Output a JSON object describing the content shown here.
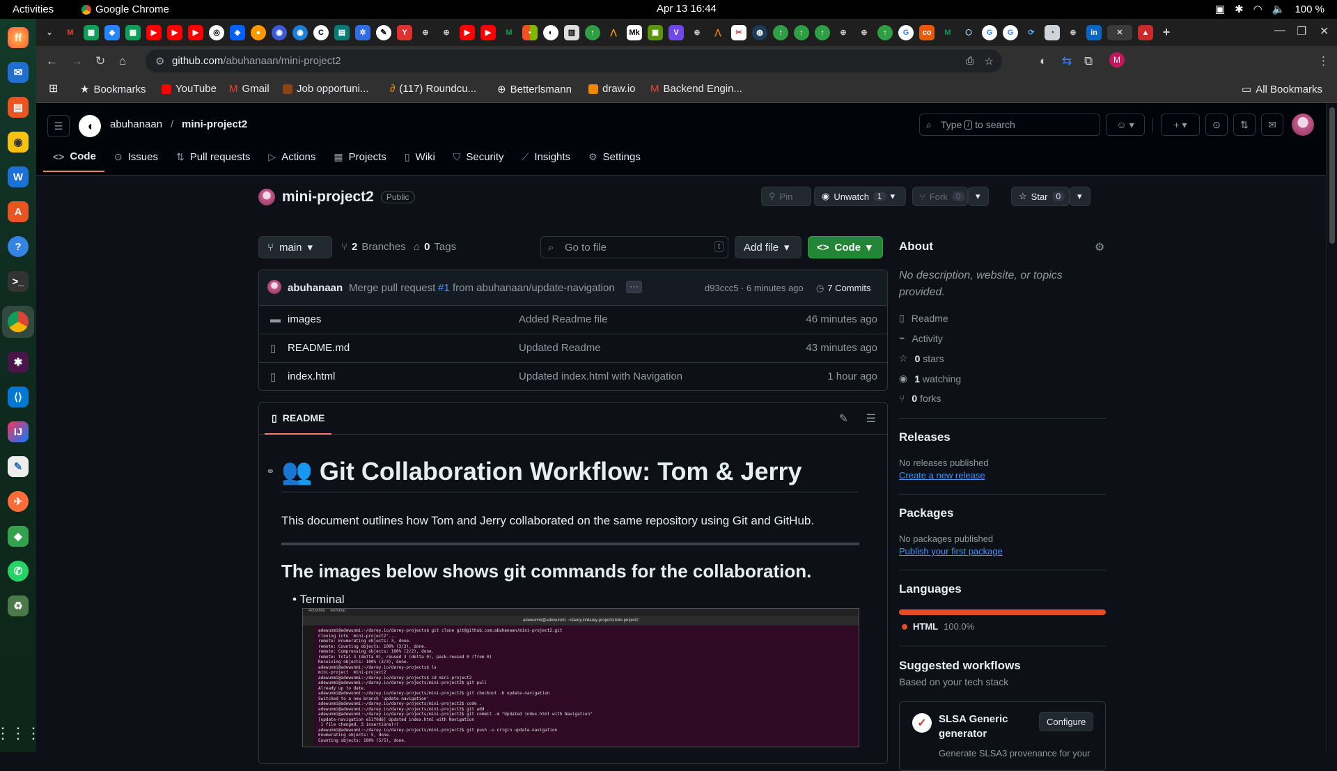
{
  "os": {
    "activities": "Activities",
    "app_name": "Google Chrome",
    "clock": "Apr 13  16:44",
    "battery": "100 %"
  },
  "browser": {
    "url_host": "github.com",
    "url_path": "/abuhanaan/mini-project2",
    "bookmarks": [
      "Bookmarks",
      "YouTube",
      "Gmail",
      "Job opportuni...",
      "(117) Roundcu...",
      "Betterlsmann",
      "draw.io",
      "Backend Engin..."
    ],
    "all_bookmarks": "All Bookmarks"
  },
  "header": {
    "owner": "abuhanaan",
    "sep": "/",
    "repo": "mini-project2",
    "search_placeholder_pre": "Type",
    "search_key": "/",
    "search_placeholder_post": "to search"
  },
  "repo_nav": [
    "Code",
    "Issues",
    "Pull requests",
    "Actions",
    "Projects",
    "Wiki",
    "Security",
    "Insights",
    "Settings"
  ],
  "repo": {
    "name": "mini-project2",
    "visibility": "Public",
    "pin": "Pin",
    "unwatch": "Unwatch",
    "watch_count": "1",
    "fork": "Fork",
    "fork_count": "0",
    "star": "Star",
    "star_count": "0"
  },
  "branchbar": {
    "branch": "main",
    "branches_count": "2",
    "branches_label": "Branches",
    "tags_count": "0",
    "tags_label": "Tags",
    "goto_placeholder": "Go to file",
    "goto_key": "t",
    "add_file": "Add file",
    "code": "Code"
  },
  "commit": {
    "author": "abuhanaan",
    "msg_pre": "Merge pull request",
    "pr": "#1",
    "msg_post": "from abuhanaan/update-navigation",
    "sha_time": "d93ccc5 · 6 minutes ago",
    "commits": "7 Commits"
  },
  "files": [
    {
      "name": "images",
      "type": "dir",
      "message": "Added Readme file",
      "time": "46 minutes ago"
    },
    {
      "name": "README.md",
      "type": "file",
      "message": "Updated Readme",
      "time": "43 minutes ago"
    },
    {
      "name": "index.html",
      "type": "file",
      "message": "Updated index.html with Navigation",
      "time": "1 hour ago"
    }
  ],
  "readme": {
    "tab": "README",
    "title_emoji": "👥",
    "title": "Git Collaboration Workflow: Tom & Jerry",
    "intro": "This document outlines how Tom and Jerry collaborated on the same repository using Git and GitHub.",
    "h2": "The images below shows git commands for the collaboration.",
    "bullet": "Terminal",
    "terminal_lines": "adewunmi@adewunmi:~/darey.io/darey-projects$ git clone git@github.com:abuhanaan/mini-project2.git\nCloning into 'mini-project2'...\nremote: Enumerating objects: 3, done.\nremote: Counting objects: 100% (3/3), done.\nremote: Compressing objects: 100% (2/2), done.\nremote: Total 3 (delta 0), reused 3 (delta 0), pack-reused 0 (from 0)\nReceiving objects: 100% (3/3), done.\nadewunmi@adewunmi:~/darey.io/darey-projects$ ls\nmini-project  mini-project2\nadewunmi@adewunmi:~/darey.io/darey-projects$ cd mini-project2\nadewunmi@adewunmi:~/darey.io/darey-projects/mini-project2$ git pull\nAlready up to date.\nadewunmi@adewunmi:~/darey.io/darey-projects/mini-project2$ git checkout -b update-navigation\nSwitched to a new branch 'update-navigation'\nadewunmi@adewunmi:~/darey.io/darey-projects/mini-project2$ code .\nadewunmi@adewunmi:~/darey.io/darey-projects/mini-project2$ git add .\nadewunmi@adewunmi:~/darey.io/darey-projects/mini-project2$ git commit -m \"Updated index.html with Navigation\"\n[update-navigation e51f0d6] Updated index.html with Navigation\n 1 file changed, 3 insertions(+)\nadewunmi@adewunmi:~/darey.io/darey-projects/mini-project2$ git push -u origin update-navigation\nEnumerating objects: 5, done.\nCounting objects: 100% (5/5), done.",
    "terminal_title": "adewunmi@adewunmi: ~/darey.io/darey-projects/mini-project2"
  },
  "about": {
    "title": "About",
    "desc": "No description, website, or topics provided.",
    "items": [
      {
        "icon": "book-icon",
        "label": "Readme",
        "bold": ""
      },
      {
        "icon": "pulse-icon",
        "label": "Activity",
        "bold": ""
      },
      {
        "icon": "star-icon",
        "label": "stars",
        "bold": "0"
      },
      {
        "icon": "eye-icon",
        "label": "watching",
        "bold": "1"
      },
      {
        "icon": "fork-icon",
        "label": "forks",
        "bold": "0"
      }
    ]
  },
  "releases": {
    "title": "Releases",
    "none": "No releases published",
    "link": "Create a new release"
  },
  "packages": {
    "title": "Packages",
    "none": "No packages published",
    "link": "Publish your first package"
  },
  "languages": {
    "title": "Languages",
    "name": "HTML",
    "pct": "100.0%",
    "color": "#e34c26"
  },
  "workflows": {
    "title": "Suggested workflows",
    "sub": "Based on your tech stack",
    "card_title": "SLSA Generic generator",
    "configure": "Configure",
    "card_desc": "Generate SLSA3 provenance for your"
  }
}
